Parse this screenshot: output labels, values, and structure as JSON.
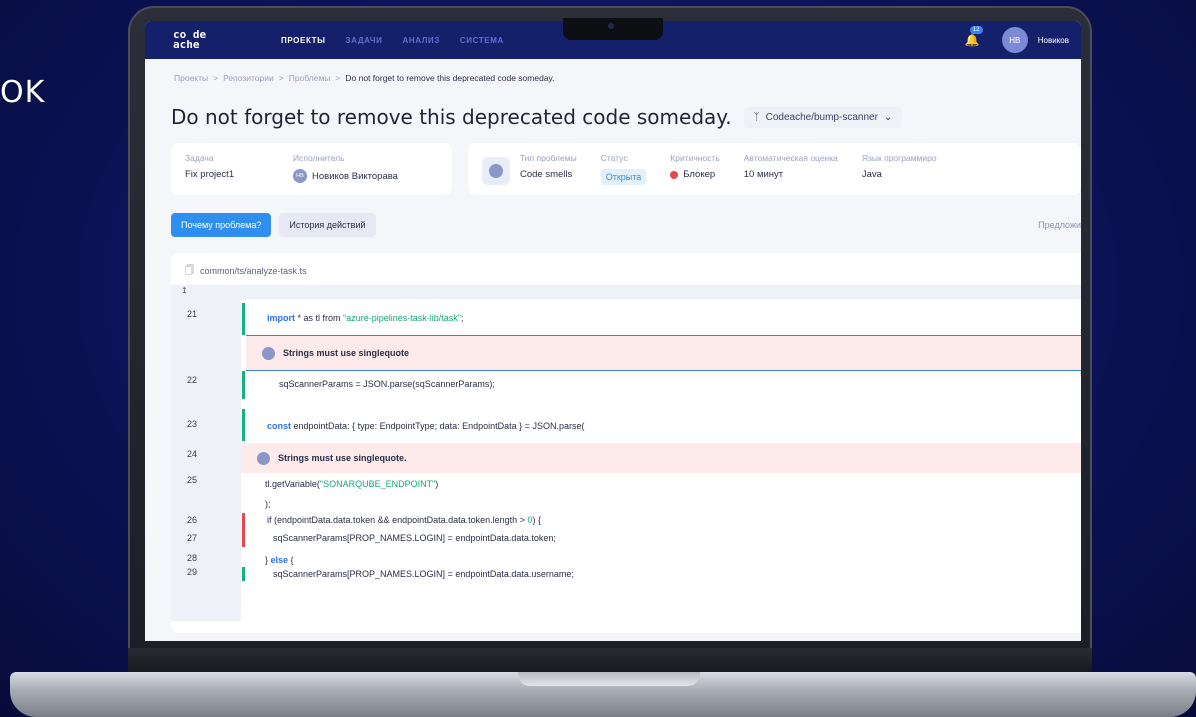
{
  "side_text": "OK",
  "app": {
    "logo_line1": "co de",
    "logo_line2": "ache",
    "nav": [
      "ПРОЕКТЫ",
      "ЗАДАЧИ",
      "АНАЛИЗ",
      "СИСТЕМА"
    ],
    "notif_count": "12",
    "user_initials": "НВ",
    "user_name": "Новиков"
  },
  "breadcrumb": [
    "Проекты",
    "Репозитории",
    "Проблемы",
    "Do not forget to remove this deprecated code someday."
  ],
  "issue_title": "Do not forget to remove this deprecated code someday.",
  "repo": "Codeache/bump-scanner",
  "task_card": {
    "task_label": "Задача",
    "task_value": "Fix project1",
    "assignee_label": "Исполнитель",
    "assignee_initials": "НВ",
    "assignee_value": "Новиков Викторава"
  },
  "meta_card": {
    "type_label": "Тип проблемы",
    "type_value": "Code smells",
    "status_label": "Статус",
    "status_value": "Открыта",
    "severity_label": "Критичность",
    "severity_value": "Блокер",
    "estimate_label": "Автоматическая оценка",
    "estimate_value": "10 минут",
    "lang_label": "Язык программиро",
    "lang_value": "Java"
  },
  "tabs": {
    "why": "Почему проблема?",
    "history": "История действий",
    "suggest": "Предложи"
  },
  "file_path": "common/ts/analyze-task.ts",
  "code": {
    "l21_num": "21",
    "l21_kw": "import",
    "l21_rest": " * as tl from ",
    "l21_str": "\"azure-pipelines-task-lib/task\"",
    "l21_end": ";",
    "issue1": "Strings must use singlequote",
    "l22_num": "22",
    "l22": "sqScannerParams = JSON.parse(sqScannerParams);",
    "l23_num": "23",
    "l23_kw": "const",
    "l23_rest": " endpointData: { type: EndpointType; data: EndpointData } = JSON.parse(",
    "l24_num": "24",
    "issue2": "Strings must use singlequote.",
    "l25_num": "25",
    "l25_pre": "tl.getVariable(",
    "l25_str": "\"SONARQUBE_ENDPOINT\"",
    "l25_end": ")",
    "l25b": ");",
    "l26_num": "26",
    "l26_kw": "if",
    "l26_rest": " if (endpointData.data.token && endpointData.data.token.length > ",
    "l26_num_lit": "0",
    "l26_end": ") {",
    "l27_num": "27",
    "l27": "sqScannerParams[PROP_NAMES.LOGIN] = endpointData.data.token;",
    "l28_num": "28",
    "l28_pre": "} ",
    "l28_kw": "else",
    "l28_end": " {",
    "l29_num": "29",
    "l29": "sqScannerParams[PROP_NAMES.LOGIN] = endpointData.data.username;"
  }
}
